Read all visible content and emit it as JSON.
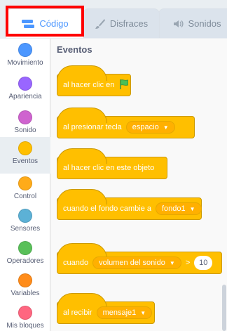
{
  "tabs": {
    "code": "Código",
    "costumes": "Disfraces",
    "sounds": "Sonidos"
  },
  "categories": [
    {
      "label": "Movimiento",
      "color": "#4c97ff"
    },
    {
      "label": "Apariencia",
      "color": "#9966ff"
    },
    {
      "label": "Sonido",
      "color": "#cf63cf"
    },
    {
      "label": "Eventos",
      "color": "#ffbf00"
    },
    {
      "label": "Control",
      "color": "#ffab19"
    },
    {
      "label": "Sensores",
      "color": "#5cb1d6"
    },
    {
      "label": "Operadores",
      "color": "#59c059"
    },
    {
      "label": "Variables",
      "color": "#ff8c1a"
    },
    {
      "label": "Mis bloques",
      "color": "#ff6680"
    }
  ],
  "palette": {
    "title": "Eventos",
    "blocks": {
      "flag_clicked": "al hacer clic en",
      "key_pressed": "al presionar tecla",
      "key_value": "espacio",
      "sprite_clicked": "al hacer clic en este objeto",
      "backdrop_switches": "cuando el fondo cambie a",
      "backdrop_value": "fondo1",
      "greater_than_when": "cuando",
      "greater_than_menu": "volumen del sonido",
      "greater_than_sign": ">",
      "greater_than_value": "10",
      "broadcast_received": "al recibir",
      "broadcast_value": "mensaje1"
    }
  },
  "icons": {
    "code_tab": "code-icon",
    "costumes_tab": "brush-icon",
    "sounds_tab": "speaker-icon",
    "flag": "green-flag-icon"
  },
  "colors": {
    "events": "#ffbf00",
    "highlight": "#ff0000",
    "active_tab_text": "#4c97ff"
  }
}
